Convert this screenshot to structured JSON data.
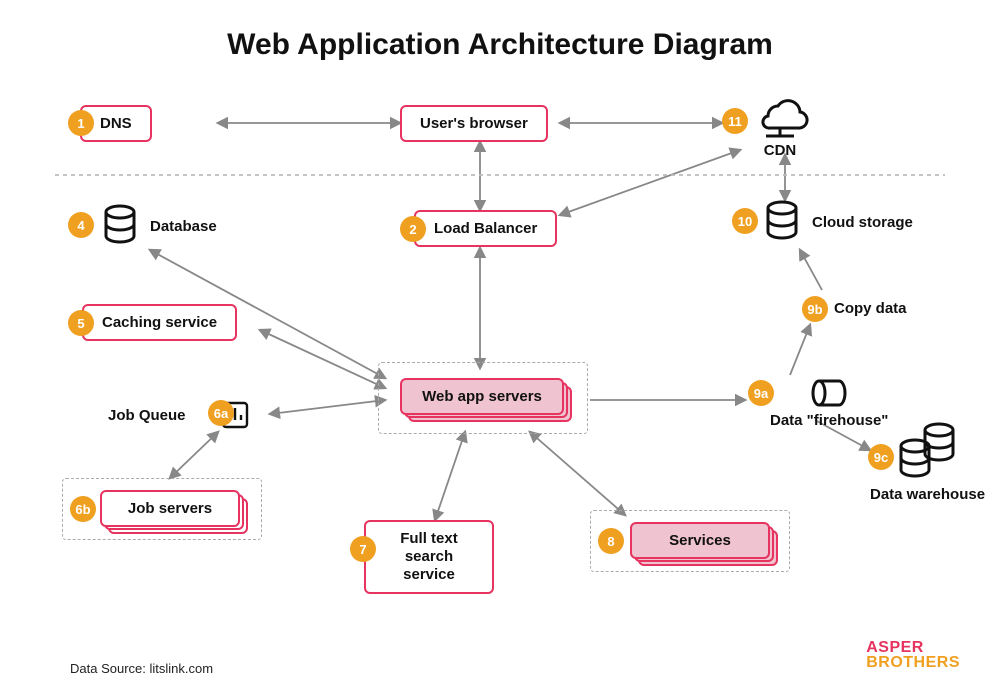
{
  "title": "Web Application Architecture Diagram",
  "nodes": {
    "dns": {
      "num": "1",
      "label": "DNS"
    },
    "browser": {
      "label": "User's browser"
    },
    "cdn": {
      "num": "11",
      "label": "CDN"
    },
    "load_balancer": {
      "num": "2",
      "label": "Load Balancer"
    },
    "database": {
      "num": "4",
      "label": "Database"
    },
    "cloud_storage": {
      "num": "10",
      "label": "Cloud storage"
    },
    "caching": {
      "num": "5",
      "label": "Caching service"
    },
    "web_app": {
      "label": "Web app servers"
    },
    "job_queue": {
      "num": "6a",
      "label": "Job Queue"
    },
    "job_servers": {
      "num": "6b",
      "label": "Job servers"
    },
    "fulltext": {
      "num": "7",
      "label": "Full text search service"
    },
    "services": {
      "num": "8",
      "label": "Services"
    },
    "firehose": {
      "num": "9a",
      "label": "Data \"firehouse\""
    },
    "copy_data": {
      "num": "9b",
      "label": "Copy data"
    },
    "warehouse": {
      "num": "9c",
      "label": "Data warehouse"
    }
  },
  "footer": {
    "source": "Data Source: litslink.com"
  },
  "logo": {
    "line1": "ASPER",
    "line2": "BROTHERS"
  },
  "colors": {
    "accent": "#e6335f",
    "badge": "#f0a020"
  }
}
